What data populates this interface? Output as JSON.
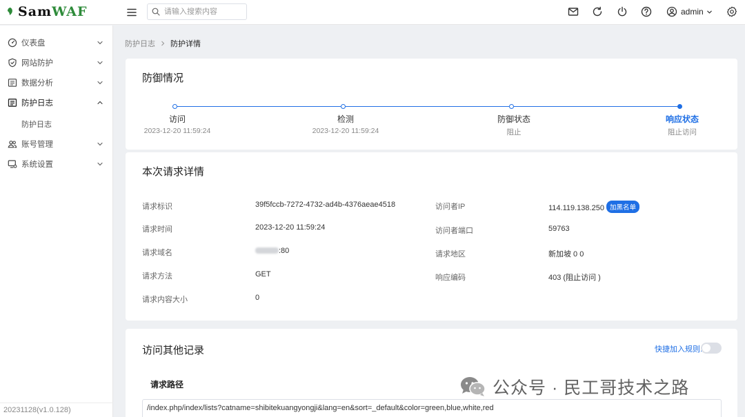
{
  "header": {
    "logo_sam": "Sam",
    "logo_waf": "WAF",
    "search_placeholder": "请输入搜索内容",
    "user_name": "admin"
  },
  "sidebar": {
    "items": [
      {
        "label": "仪表盘",
        "icon": "dashboard-icon"
      },
      {
        "label": "网站防护",
        "icon": "shield-icon"
      },
      {
        "label": "数据分析",
        "icon": "chart-icon"
      },
      {
        "label": "防护日志",
        "icon": "log-icon"
      },
      {
        "label": "账号管理",
        "icon": "users-icon"
      },
      {
        "label": "系统设置",
        "icon": "settings-icon"
      }
    ],
    "sub_item": "防护日志",
    "version": "20231128(v1.0.128)"
  },
  "breadcrumb": {
    "parent": "防护日志",
    "current": "防护详情"
  },
  "defense": {
    "title": "防御情况",
    "steps": [
      {
        "title": "访问",
        "desc": "2023-12-20 11:59:24"
      },
      {
        "title": "检测",
        "desc": "2023-12-20 11:59:24"
      },
      {
        "title": "防御状态",
        "desc": "阻止"
      },
      {
        "title": "响应状态",
        "desc": "阻止访问"
      }
    ]
  },
  "detail": {
    "title": "本次请求详情",
    "left": [
      {
        "label": "请求标识",
        "value": "39f5fccb-7272-4732-ad4b-4376aeae4518"
      },
      {
        "label": "请求时间",
        "value": "2023-12-20 11:59:24"
      },
      {
        "label": "请求域名",
        "value": ":80"
      },
      {
        "label": "请求方法",
        "value": "GET"
      },
      {
        "label": "请求内容大小",
        "value": "0"
      }
    ],
    "right": [
      {
        "label": "访问者IP",
        "value": "114.119.138.250"
      },
      {
        "label": "访问者端口",
        "value": "59763"
      },
      {
        "label": "请求地区",
        "value": "新加坡 0 0"
      },
      {
        "label": "响应编码",
        "value": "403 (阻止访问 )"
      }
    ],
    "blacklist_button": "加黑名单"
  },
  "other": {
    "title": "访问其他记录",
    "quick_rule_label": "快捷加入规则:",
    "quick_rule_on": false,
    "path_heading": "请求路径",
    "path_value": "/index.php/index/lists?catname=shibitekuangyongji&lang=en&sort=_default&color=green,blue,white,red"
  },
  "watermark": {
    "text": "公众号 · 民工哥技术之路"
  },
  "colors": {
    "primary": "#1f6fe5",
    "logo_green": "#2e8b3a",
    "background": "#eef0f3"
  }
}
